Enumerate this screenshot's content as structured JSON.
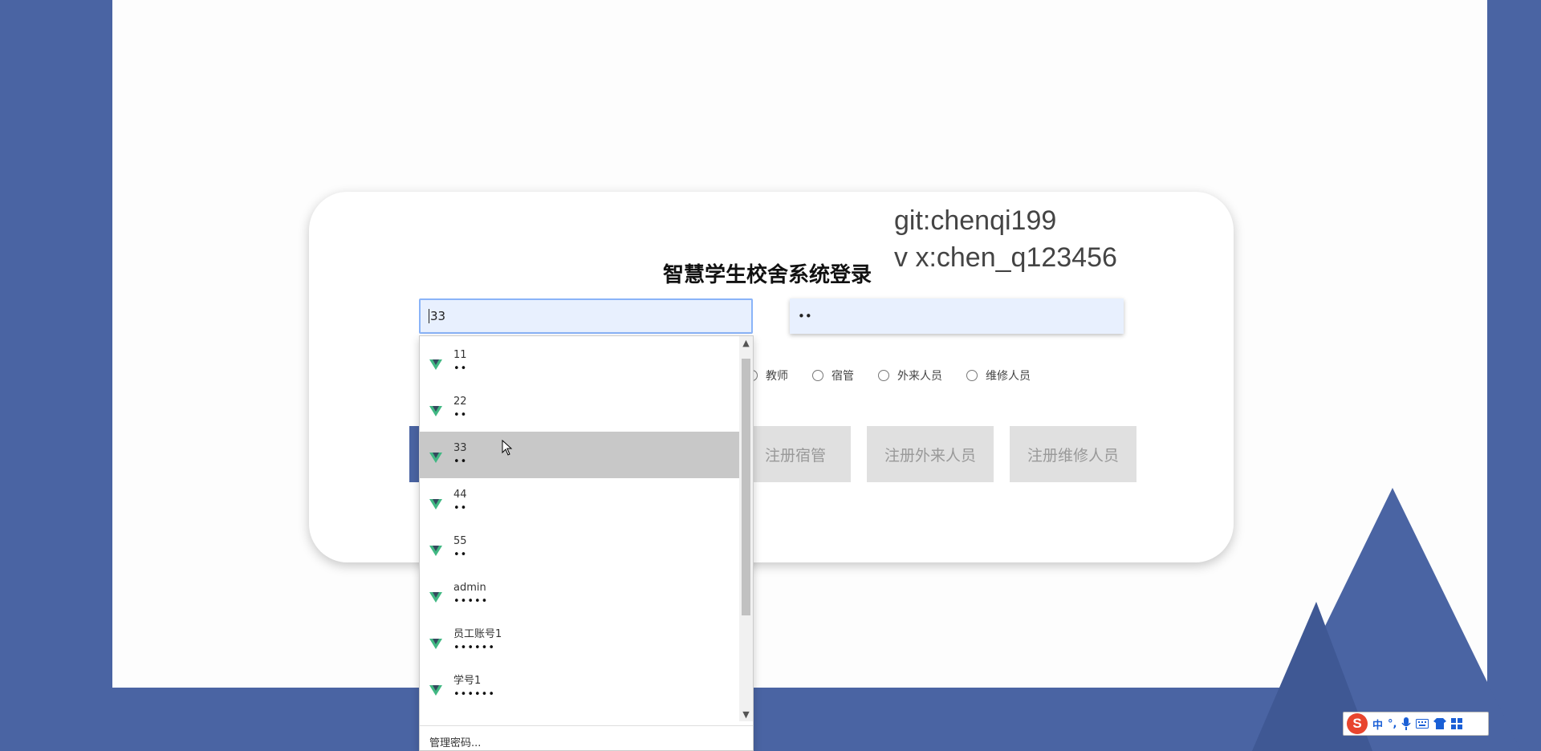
{
  "watermark": {
    "line1": "git:chenqi199",
    "line2": "v x:chen_q123456"
  },
  "login": {
    "title": "智慧学生校舍系统登录",
    "username_value": "33",
    "password_value": "••"
  },
  "roles": [
    "教师",
    "宿管",
    "外来人员",
    "维修人员"
  ],
  "buttons": [
    "注册宿管",
    "注册外来人员",
    "注册维修人员"
  ],
  "autocomplete": {
    "items": [
      {
        "name": "11",
        "password": "••"
      },
      {
        "name": "22",
        "password": "••"
      },
      {
        "name": "33",
        "password": "••"
      },
      {
        "name": "44",
        "password": "••"
      },
      {
        "name": "55",
        "password": "••"
      },
      {
        "name": "admin",
        "password": "•••••"
      },
      {
        "name": "员工账号1",
        "password": "••••••"
      },
      {
        "name": "学号1",
        "password": "••••••"
      }
    ],
    "selected_index": 2,
    "manage_label": "管理密码..."
  },
  "ime": {
    "mode": "中",
    "punct": "°,",
    "icons": [
      "mic-icon",
      "keyboard-icon",
      "skin-icon",
      "apps-icon"
    ]
  },
  "colors": {
    "background": "#4a64a3",
    "accent": "#4a64a3",
    "input_fill": "#e8f0fe"
  }
}
